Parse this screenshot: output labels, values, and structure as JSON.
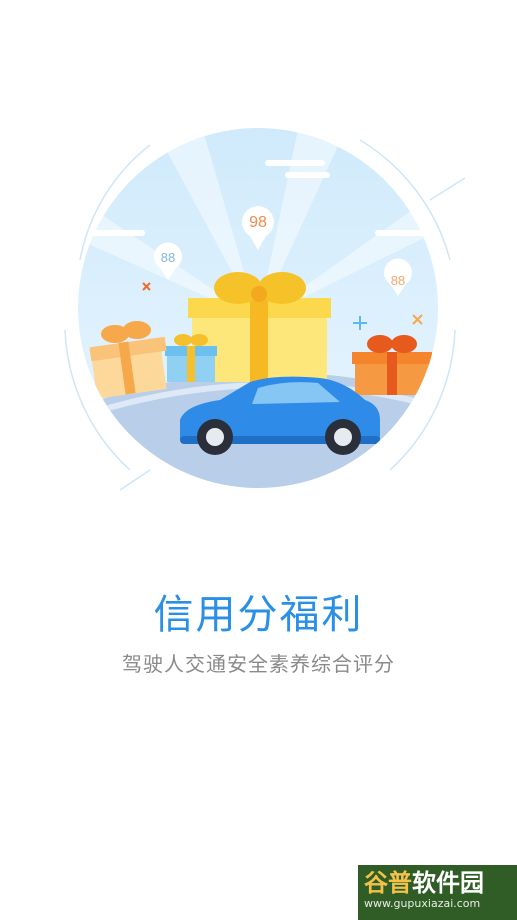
{
  "hero": {
    "bubbles": [
      "98",
      "88",
      "88"
    ]
  },
  "title": "信用分福利",
  "subtitle": "驾驶人交通安全素养综合评分",
  "watermark": {
    "name_accent": "谷普",
    "name_rest": "软件园",
    "url": "www.gupuxiazai.com"
  },
  "colors": {
    "title": "#2a8fe6",
    "subtitle": "#8a8a8a",
    "car": "#2f8be8",
    "sky": "#d7effc"
  }
}
